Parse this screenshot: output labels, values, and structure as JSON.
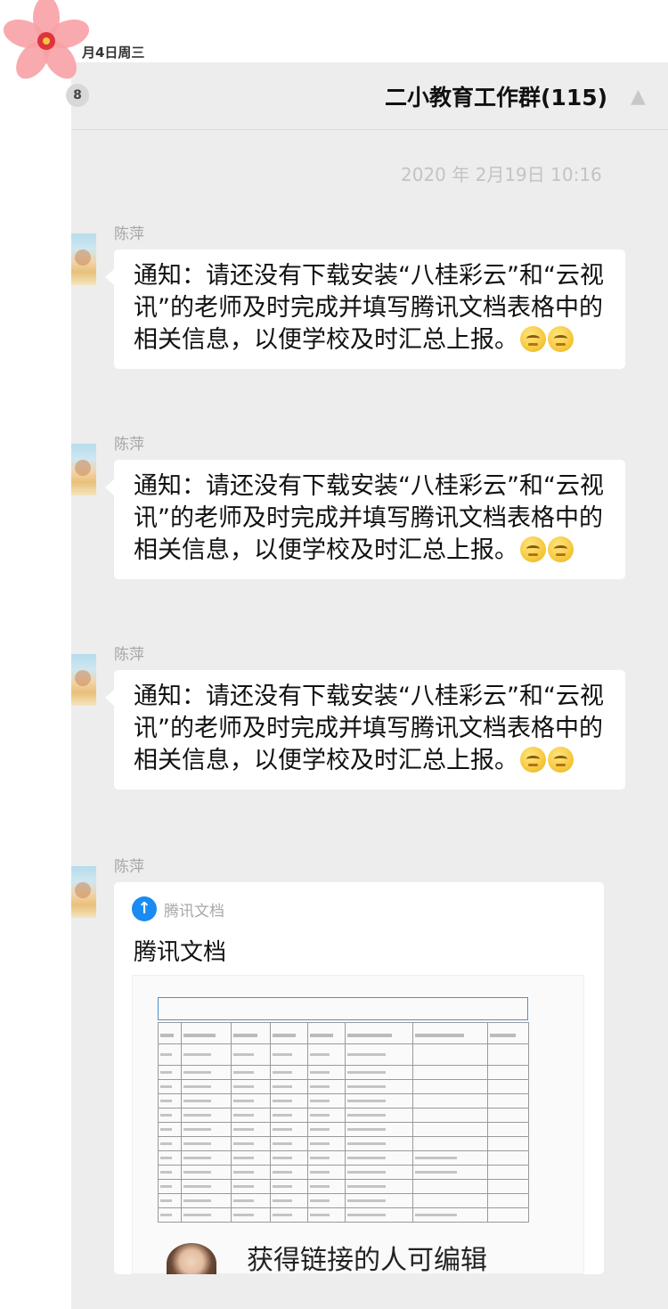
{
  "status_bar": {
    "date": "月4日周三"
  },
  "header": {
    "badge": "8",
    "title": "二小教育工作群(115)",
    "menu_icon": "more-icon"
  },
  "chat": {
    "timestamp": "2020 年 2月19日 10:16",
    "messages": [
      {
        "sender": "陈萍",
        "text": "通知：请还没有下载安装“八桂彩云”和“云视讯”的老师及时完成并填写腾讯文档表格中的相关信息，以便学校及时汇总上报。"
      },
      {
        "sender": "陈萍",
        "text": "通知：请还没有下载安装“八桂彩云”和“云视讯”的老师及时完成并填写腾讯文档表格中的相关信息，以便学校及时汇总上报。"
      },
      {
        "sender": "陈萍",
        "text": "通知：请还没有下载安装“八桂彩云”和“云视讯”的老师及时完成并填写腾讯文档表格中的相关信息，以便学校及时汇总上报。"
      }
    ],
    "card": {
      "sender": "陈萍",
      "source_name": "腾讯文档",
      "title": "腾讯文档",
      "permission": "获得链接的人可编辑"
    }
  },
  "colors": {
    "chat_background": "#ededed",
    "bubble": "#ffffff",
    "tencent_docs_blue": "#1a8bf0"
  }
}
